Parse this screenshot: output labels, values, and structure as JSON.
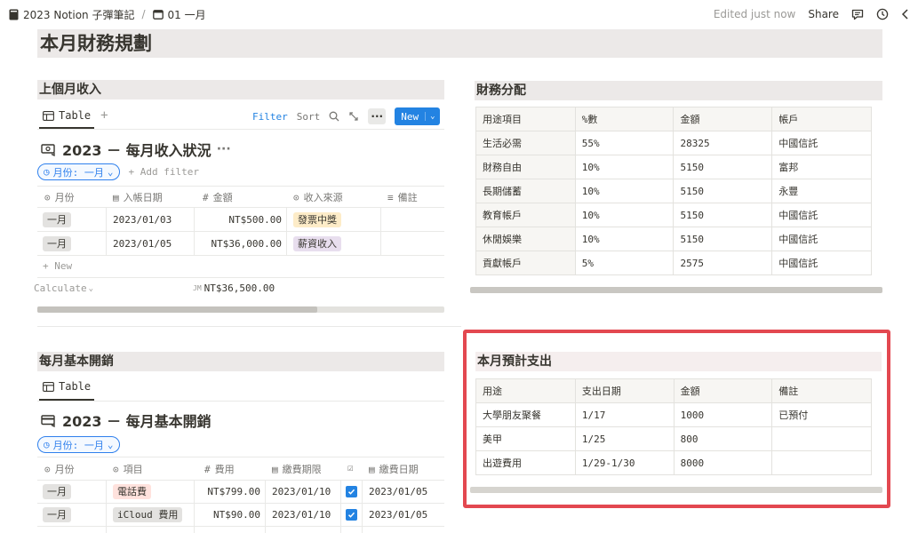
{
  "topbar": {
    "workspace": "2023 Notion 子彈筆記",
    "page": "01 一月",
    "edited": "Edited just now",
    "share": "Share"
  },
  "page_title": "本月財務規劃",
  "income": {
    "section": "上個月收入",
    "tab": "Table",
    "filter": "Filter",
    "sort": "Sort",
    "new": "New",
    "title": "2023 － 每月收入狀況",
    "filter_pill": "月份: 一月",
    "add_filter": "+ Add filter",
    "columns": [
      "月份",
      "入帳日期",
      "金額",
      "收入來源",
      "備註"
    ],
    "rows": [
      {
        "month": "一月",
        "date": "2023/01/03",
        "amount": "NT$500.00",
        "source": "發票中獎"
      },
      {
        "month": "一月",
        "date": "2023/01/05",
        "amount": "NT$36,000.00",
        "source": "薪資收入"
      }
    ],
    "add_row": "+ New",
    "calculate": "Calculate",
    "sum_prefix": "JM",
    "sum": "NT$36,500.00"
  },
  "expenses": {
    "section": "每月基本開銷",
    "tab": "Table",
    "title": "2023 － 每月基本開銷",
    "filter_pill": "月份: 一月",
    "columns": [
      "月份",
      "項目",
      "費用",
      "繳費期限",
      "",
      "繳費日期"
    ],
    "rows": [
      {
        "month": "一月",
        "item": "電話費",
        "fee": "NT$799.00",
        "deadline": "2023/01/10",
        "paid": true,
        "paid_date": "2023/01/05"
      },
      {
        "month": "一月",
        "item": "iCloud 費用",
        "fee": "NT$90.00",
        "deadline": "2023/01/10",
        "paid": true,
        "paid_date": "2023/01/05"
      }
    ]
  },
  "allocation": {
    "section": "財務分配",
    "columns": [
      "用途項目",
      "%數",
      "金額",
      "帳戶"
    ],
    "rows": [
      [
        "生活必需",
        "55%",
        "28325",
        "中國信託"
      ],
      [
        "財務自由",
        "10%",
        "5150",
        "富邦"
      ],
      [
        "長期儲蓄",
        "10%",
        "5150",
        "永豐"
      ],
      [
        "教育帳戶",
        "10%",
        "5150",
        "中國信託"
      ],
      [
        "休閒娛樂",
        "10%",
        "5150",
        "中國信託"
      ],
      [
        "貢獻帳戶",
        "5%",
        "2575",
        "中國信託"
      ]
    ]
  },
  "planned": {
    "section": "本月預計支出",
    "columns": [
      "用途",
      "支出日期",
      "金額",
      "備註"
    ],
    "rows": [
      [
        "大學朋友聚餐",
        "1/17",
        "1000",
        "已預付"
      ],
      [
        "美甲",
        "1/25",
        "800",
        ""
      ],
      [
        "出遊費用",
        "1/29-1/30",
        "8000",
        ""
      ]
    ]
  },
  "colors": {
    "accent": "#2383e2",
    "highlight": "#e34850",
    "section_bg": "#ece9e8",
    "tag_red": "#ffe2dd",
    "tag_yellow": "#fdecc8",
    "tag_purple": "#e8deee",
    "tag_gray": "#e3e2e0"
  }
}
